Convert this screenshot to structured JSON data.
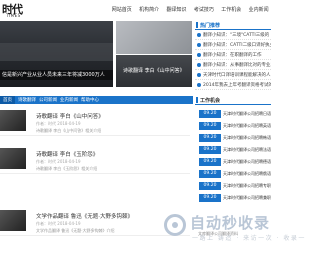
{
  "header": {
    "logo_cn": "时代",
    "logo_en": "TIMES",
    "nav": [
      "网站首页",
      "机构简介",
      "翻译知识",
      "考试技巧",
      "工作机会",
      "业内新闻"
    ]
  },
  "hero": {
    "main_caption": "信是新兴产业从业人员未来三年将减3000万人",
    "side2_caption": "诗歌翻译 李白《山中问答》"
  },
  "hot_panel": {
    "title": "热门推荐",
    "items": [
      "翻译小知识：\"三境\"CATTI三级的",
      "翻译小知识：CATTI二级口译好执业",
      "翻译小知识：在职翻译的工作",
      "翻译小知识：从事翻译比对的专业工作",
      "天津时代口译培训课程能解决的人",
      "2014年我去上年考翻译资格考试的技巧方法"
    ]
  },
  "subnav": {
    "items": [
      "首页",
      "诗歌翻译",
      "公司新闻",
      "业内新闻",
      "帮助中心"
    ]
  },
  "articles": [
    {
      "title": "诗歌翻译 李白《山中问答》",
      "meta": "作者：时代  2018-04-19",
      "desc": "诗歌翻译 李白《山中问答》相关介绍"
    },
    {
      "title": "诗歌翻译 李白《玉阶怨》",
      "meta": "作者：时代  2018-04-19",
      "desc": "诗歌翻译 李白《玉阶怨》相关介绍"
    },
    {
      "title": "文学作品翻译 鲁迅《无题·大野多钩棘》",
      "meta": "作者：时代  2018-04-19",
      "desc": "文学作品翻译 鲁迅《无题·大野多钩棘》介绍"
    }
  ],
  "job_panel": {
    "title": "工作机会",
    "items": [
      {
        "date": "09.20",
        "title": "天津时代翻译公司招聘日语"
      },
      {
        "date": "09.20",
        "title": "天津时代翻译公司招聘英语"
      },
      {
        "date": "09.20",
        "title": "天津时代翻译公司招聘韩语"
      },
      {
        "date": "09.20",
        "title": "天津时代翻译公司招聘法语"
      },
      {
        "date": "09.20",
        "title": "天津时代翻译公司招聘德语"
      },
      {
        "date": "09.20",
        "title": "天津时代翻译公司招聘俄语"
      },
      {
        "date": "09.20",
        "title": "天津时代翻译公司招聘专职"
      },
      {
        "date": "09.20",
        "title": "天津时代翻译公司招聘兼职"
      }
    ]
  },
  "watermark": {
    "title": "自动秒收录",
    "subtitle": "一路上 铸造 · 来访一次 · 收录一"
  },
  "doc_link": "文库翻译公司翻译资料"
}
